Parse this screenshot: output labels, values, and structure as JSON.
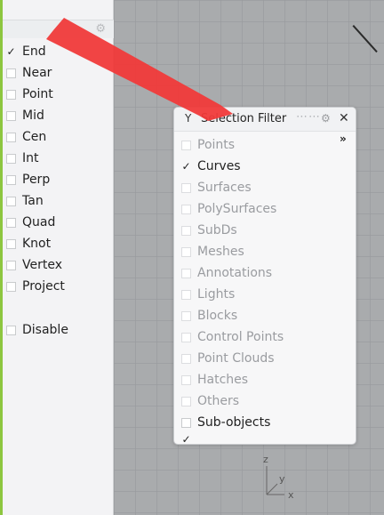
{
  "osnap": {
    "items": [
      {
        "label": "End",
        "checked": true
      },
      {
        "label": "Near",
        "checked": false
      },
      {
        "label": "Point",
        "checked": false
      },
      {
        "label": "Mid",
        "checked": false
      },
      {
        "label": "Cen",
        "checked": false
      },
      {
        "label": "Int",
        "checked": false
      },
      {
        "label": "Perp",
        "checked": false
      },
      {
        "label": "Tan",
        "checked": false
      },
      {
        "label": "Quad",
        "checked": false
      },
      {
        "label": "Knot",
        "checked": false
      },
      {
        "label": "Vertex",
        "checked": false
      },
      {
        "label": "Project",
        "checked": false
      }
    ],
    "disable_label": "Disable"
  },
  "filter": {
    "title": "Selection Filter",
    "title_icon": "filter-icon",
    "more_glyph": "»",
    "items": [
      {
        "label": "Points",
        "checked": false
      },
      {
        "label": "Curves",
        "checked": true
      },
      {
        "label": "Surfaces",
        "checked": false
      },
      {
        "label": "PolySurfaces",
        "checked": false
      },
      {
        "label": "SubDs",
        "checked": false
      },
      {
        "label": "Meshes",
        "checked": false
      },
      {
        "label": "Annotations",
        "checked": false
      },
      {
        "label": "Lights",
        "checked": false
      },
      {
        "label": "Blocks",
        "checked": false
      },
      {
        "label": "Control Points",
        "checked": false
      },
      {
        "label": "Point Clouds",
        "checked": false
      },
      {
        "label": "Hatches",
        "checked": false
      },
      {
        "label": "Others",
        "checked": false
      },
      {
        "label": "Sub-objects",
        "checked": false
      }
    ]
  },
  "axis": {
    "z": "z",
    "y": "y",
    "x": "x"
  },
  "colors": {
    "annotation_arrow": "#f03a3a",
    "panel_accent": "#8dc63f"
  }
}
